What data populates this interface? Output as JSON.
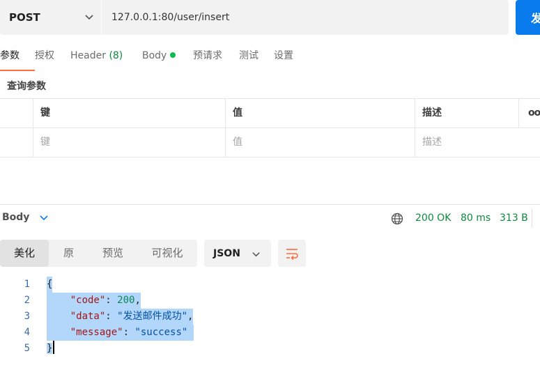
{
  "request": {
    "method": "POST",
    "url": "127.0.0.1:80/user/insert",
    "send_label": "发"
  },
  "request_tabs": {
    "params": "参数",
    "auth": "授权",
    "headers": "Header",
    "headers_count": "(8)",
    "body": "Body",
    "prerequest": "预请求",
    "tests": "测试",
    "settings": "设置"
  },
  "params": {
    "section_title": "查询参数",
    "columns": {
      "key": "键",
      "value": "值",
      "description": "描述",
      "more": "ooo"
    },
    "placeholder_row": {
      "key": "键",
      "value": "值",
      "description": "描述"
    }
  },
  "response": {
    "label": "Body",
    "status": "200 OK",
    "time": "80 ms",
    "size": "313 B",
    "status_color": "#0c8a3c",
    "views": {
      "pretty": "美化",
      "raw": "原",
      "preview": "预览",
      "visualize": "可视化"
    },
    "active_view": "美化",
    "format": "JSON",
    "code_lines": [
      {
        "num": "1",
        "open": "{"
      },
      {
        "num": "2",
        "key": "\"code\"",
        "colon": ": ",
        "value": "200",
        "comma": ","
      },
      {
        "num": "3",
        "key": "\"data\"",
        "colon": ": ",
        "value": "\"发送邮件成功\"",
        "comma": ","
      },
      {
        "num": "4",
        "key": "\"message\"",
        "colon": ": ",
        "value": "\"success\""
      },
      {
        "num": "5",
        "close": "}"
      }
    ]
  },
  "colors": {
    "accent": "#ff6c37",
    "send_button": "#097bed",
    "selection": "#b3d7fb"
  },
  "icons": {
    "method_dropdown": "chevron-down-icon",
    "response_dropdown": "chevron-down-icon",
    "network": "globe-icon",
    "wrap": "wrap-lines-icon"
  }
}
